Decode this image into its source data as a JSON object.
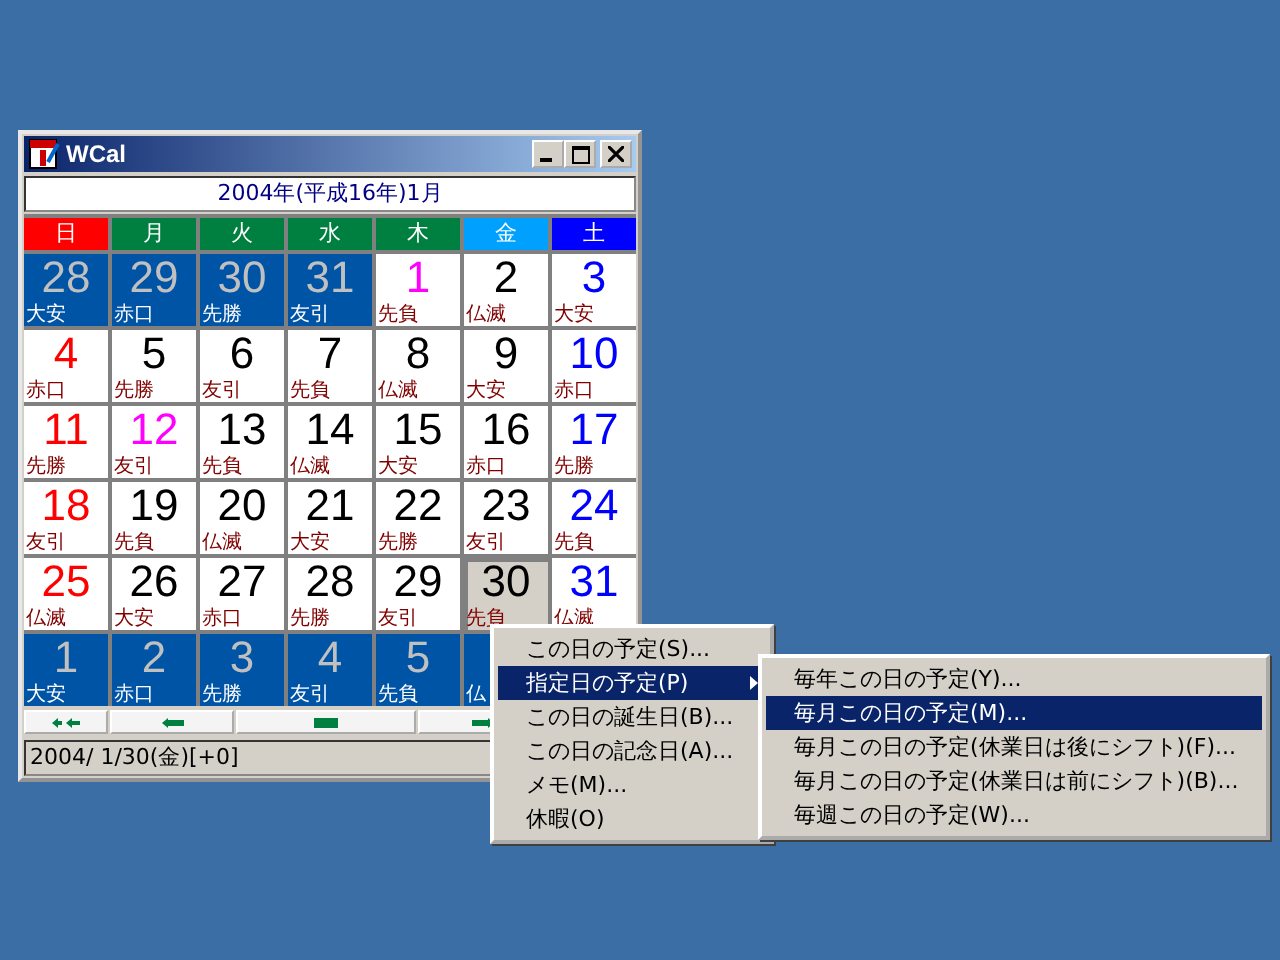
{
  "window": {
    "title": "WCal"
  },
  "month_header": "2004年(平成16年)1月",
  "weekdays": [
    {
      "label": "日",
      "color": "#ff0000"
    },
    {
      "label": "月",
      "color": "#008040"
    },
    {
      "label": "火",
      "color": "#008040"
    },
    {
      "label": "水",
      "color": "#008040"
    },
    {
      "label": "木",
      "color": "#008040"
    },
    {
      "label": "金",
      "color": "#00a0ff"
    },
    {
      "label": "土",
      "color": "#0000ff"
    }
  ],
  "weeks": [
    [
      {
        "day": "28",
        "rokuyo": "大安",
        "kind": "other"
      },
      {
        "day": "29",
        "rokuyo": "赤口",
        "kind": "other"
      },
      {
        "day": "30",
        "rokuyo": "先勝",
        "kind": "other"
      },
      {
        "day": "31",
        "rokuyo": "友引",
        "kind": "other"
      },
      {
        "day": "1",
        "rokuyo": "先負",
        "kind": "normal",
        "holiday": true
      },
      {
        "day": "2",
        "rokuyo": "仏滅",
        "kind": "normal",
        "holiday": false
      },
      {
        "day": "3",
        "rokuyo": "大安",
        "kind": "normal",
        "holiday": false
      }
    ],
    [
      {
        "day": "4",
        "rokuyo": "赤口",
        "kind": "normal",
        "holiday": false
      },
      {
        "day": "5",
        "rokuyo": "先勝",
        "kind": "normal",
        "holiday": false
      },
      {
        "day": "6",
        "rokuyo": "友引",
        "kind": "normal",
        "holiday": false
      },
      {
        "day": "7",
        "rokuyo": "先負",
        "kind": "normal",
        "holiday": false
      },
      {
        "day": "8",
        "rokuyo": "仏滅",
        "kind": "normal",
        "holiday": false
      },
      {
        "day": "9",
        "rokuyo": "大安",
        "kind": "normal",
        "holiday": false
      },
      {
        "day": "10",
        "rokuyo": "赤口",
        "kind": "normal",
        "holiday": false
      }
    ],
    [
      {
        "day": "11",
        "rokuyo": "先勝",
        "kind": "normal",
        "holiday": false
      },
      {
        "day": "12",
        "rokuyo": "友引",
        "kind": "normal",
        "holiday": true
      },
      {
        "day": "13",
        "rokuyo": "先負",
        "kind": "normal",
        "holiday": false
      },
      {
        "day": "14",
        "rokuyo": "仏滅",
        "kind": "normal",
        "holiday": false
      },
      {
        "day": "15",
        "rokuyo": "大安",
        "kind": "normal",
        "holiday": false
      },
      {
        "day": "16",
        "rokuyo": "赤口",
        "kind": "normal",
        "holiday": false
      },
      {
        "day": "17",
        "rokuyo": "先勝",
        "kind": "normal",
        "holiday": false
      }
    ],
    [
      {
        "day": "18",
        "rokuyo": "友引",
        "kind": "normal",
        "holiday": false
      },
      {
        "day": "19",
        "rokuyo": "先負",
        "kind": "normal",
        "holiday": false
      },
      {
        "day": "20",
        "rokuyo": "仏滅",
        "kind": "normal",
        "holiday": false
      },
      {
        "day": "21",
        "rokuyo": "大安",
        "kind": "normal",
        "holiday": false
      },
      {
        "day": "22",
        "rokuyo": "先勝",
        "kind": "normal",
        "holiday": false
      },
      {
        "day": "23",
        "rokuyo": "友引",
        "kind": "normal",
        "holiday": false
      },
      {
        "day": "24",
        "rokuyo": "先負",
        "kind": "normal",
        "holiday": false
      }
    ],
    [
      {
        "day": "25",
        "rokuyo": "仏滅",
        "kind": "normal",
        "holiday": false
      },
      {
        "day": "26",
        "rokuyo": "大安",
        "kind": "normal",
        "holiday": false
      },
      {
        "day": "27",
        "rokuyo": "赤口",
        "kind": "normal",
        "holiday": false
      },
      {
        "day": "28",
        "rokuyo": "先勝",
        "kind": "normal",
        "holiday": false
      },
      {
        "day": "29",
        "rokuyo": "友引",
        "kind": "normal",
        "holiday": false
      },
      {
        "day": "30",
        "rokuyo": "先負",
        "kind": "today",
        "holiday": false
      },
      {
        "day": "31",
        "rokuyo": "仏滅",
        "kind": "normal",
        "holiday": false
      }
    ],
    [
      {
        "day": "1",
        "rokuyo": "大安",
        "kind": "other"
      },
      {
        "day": "2",
        "rokuyo": "赤口",
        "kind": "other"
      },
      {
        "day": "3",
        "rokuyo": "先勝",
        "kind": "other"
      },
      {
        "day": "4",
        "rokuyo": "友引",
        "kind": "other"
      },
      {
        "day": "5",
        "rokuyo": "先負",
        "kind": "other"
      },
      {
        "rokuyo": "仏",
        "kind": "other"
      }
    ]
  ],
  "nav_buttons": [
    {
      "kind": "fast-back"
    },
    {
      "kind": "back"
    },
    {
      "kind": "today"
    },
    {
      "kind": "forward"
    }
  ],
  "status": "2004/ 1/30(金)[+0]",
  "context_menu": {
    "items": [
      {
        "label": "この日の予定(S)...",
        "selected": false,
        "submenu": false
      },
      {
        "label": "指定日の予定(P)",
        "selected": true,
        "submenu": true
      },
      {
        "label": "この日の誕生日(B)...",
        "selected": false,
        "submenu": false
      },
      {
        "label": "この日の記念日(A)...",
        "selected": false,
        "submenu": false
      },
      {
        "label": "メモ(M)...",
        "selected": false,
        "submenu": false
      },
      {
        "label": "休暇(O)",
        "selected": false,
        "submenu": false
      }
    ]
  },
  "submenu": {
    "items": [
      {
        "label": "毎年この日の予定(Y)...",
        "selected": false
      },
      {
        "label": "毎月この日の予定(M)...",
        "selected": true
      },
      {
        "label": "毎月この日の予定(休業日は後にシフト)(F)...",
        "selected": false
      },
      {
        "label": "毎月この日の予定(休業日は前にシフト)(B)...",
        "selected": false
      },
      {
        "label": "毎週この日の予定(W)...",
        "selected": false
      }
    ]
  }
}
